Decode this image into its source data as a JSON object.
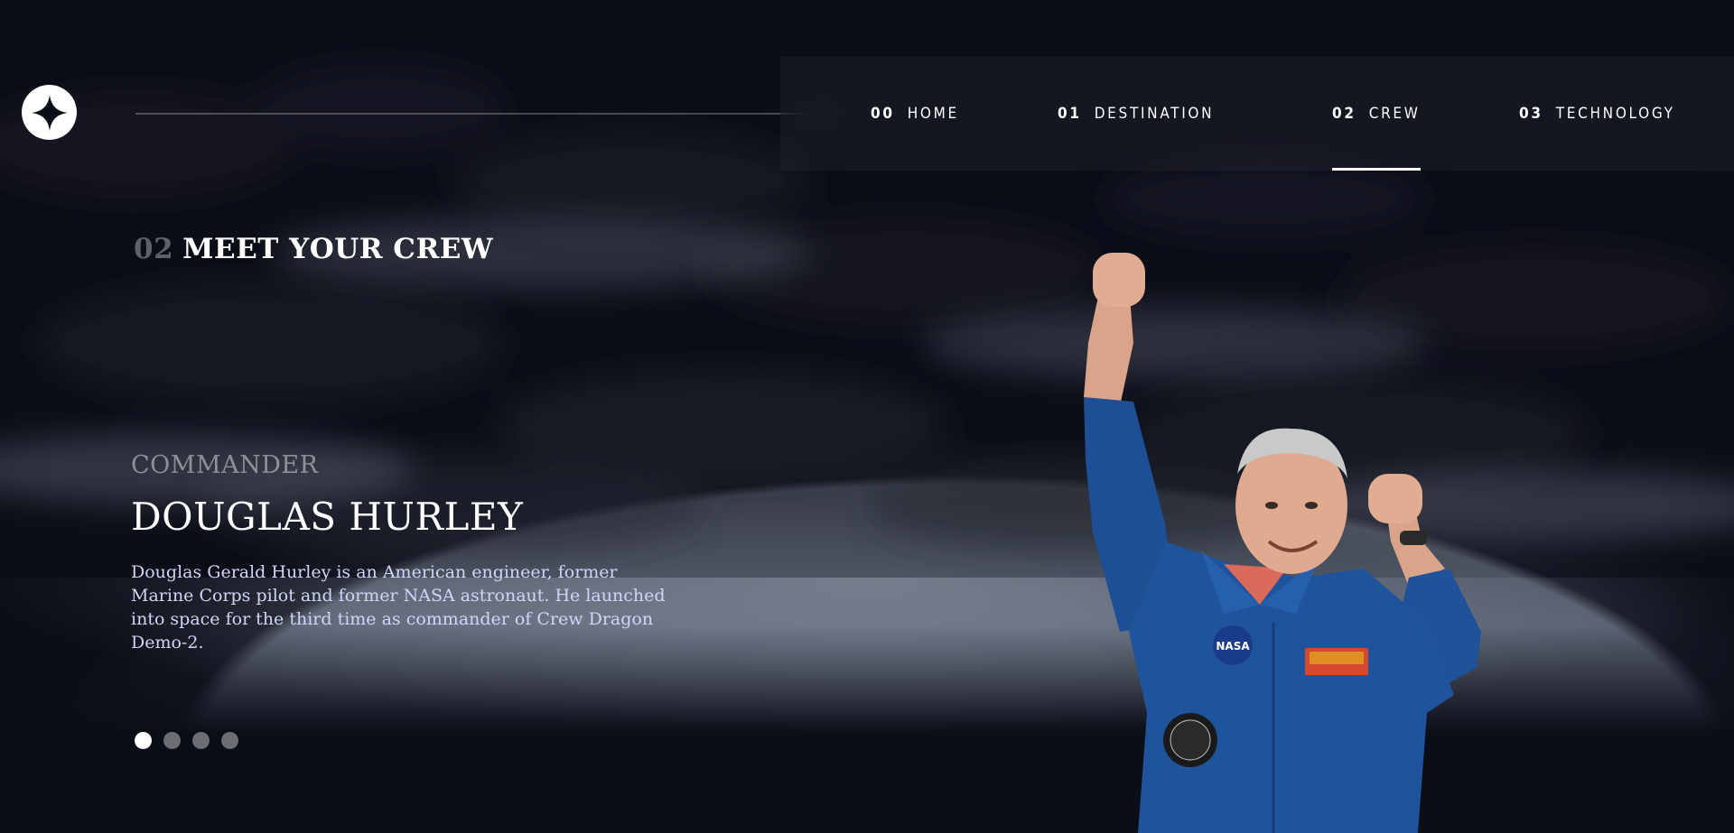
{
  "header": {
    "logo_icon": "star-logo-icon",
    "nav": [
      {
        "num": "00",
        "label": "HOME"
      },
      {
        "num": "01",
        "label": "DESTINATION"
      },
      {
        "num": "02",
        "label": "CREW"
      },
      {
        "num": "03",
        "label": "TECHNOLOGY"
      }
    ],
    "active_index": 2
  },
  "main": {
    "title_num": "02",
    "title": "MEET YOUR CREW",
    "role": "COMMANDER",
    "name": "DOUGLAS HURLEY",
    "bio": "Douglas Gerald Hurley is an American engineer, former Marine Corps pilot and former NASA astronaut. He launched into space for the third time as commander of Crew Dragon Demo-2.",
    "slider_dots": 4,
    "active_dot": 0
  },
  "colors": {
    "background": "#0b0d17",
    "accent_text": "#d0d6f9"
  }
}
